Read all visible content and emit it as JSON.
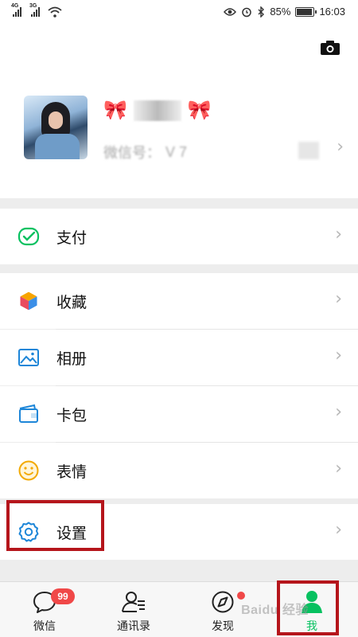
{
  "status_bar": {
    "net1": "4G",
    "net2": "3G",
    "battery": "85%",
    "time": "16:03"
  },
  "profile": {
    "nickname_left_emoji": "🎀",
    "nickname_right_emoji": "🎀",
    "wechat_id_label": "微信号：",
    "wechat_id_value": "V          7"
  },
  "menu": [
    {
      "label": "支付",
      "icon": "pay-icon"
    },
    {
      "label": "收藏",
      "icon": "favorites-cube-icon"
    },
    {
      "label": "相册",
      "icon": "album-icon"
    },
    {
      "label": "卡包",
      "icon": "card-wallet-icon"
    },
    {
      "label": "表情",
      "icon": "smiley-icon"
    },
    {
      "label": "设置",
      "icon": "gear-icon"
    }
  ],
  "tabs": [
    {
      "label": "微信",
      "badge": "99"
    },
    {
      "label": "通讯录"
    },
    {
      "label": "发现"
    },
    {
      "label": "我"
    }
  ],
  "colors": {
    "wechat_green": "#07c160",
    "badge_red": "#f04848",
    "annotation_red": "#b5151b"
  },
  "watermark": "Baidu 经验"
}
